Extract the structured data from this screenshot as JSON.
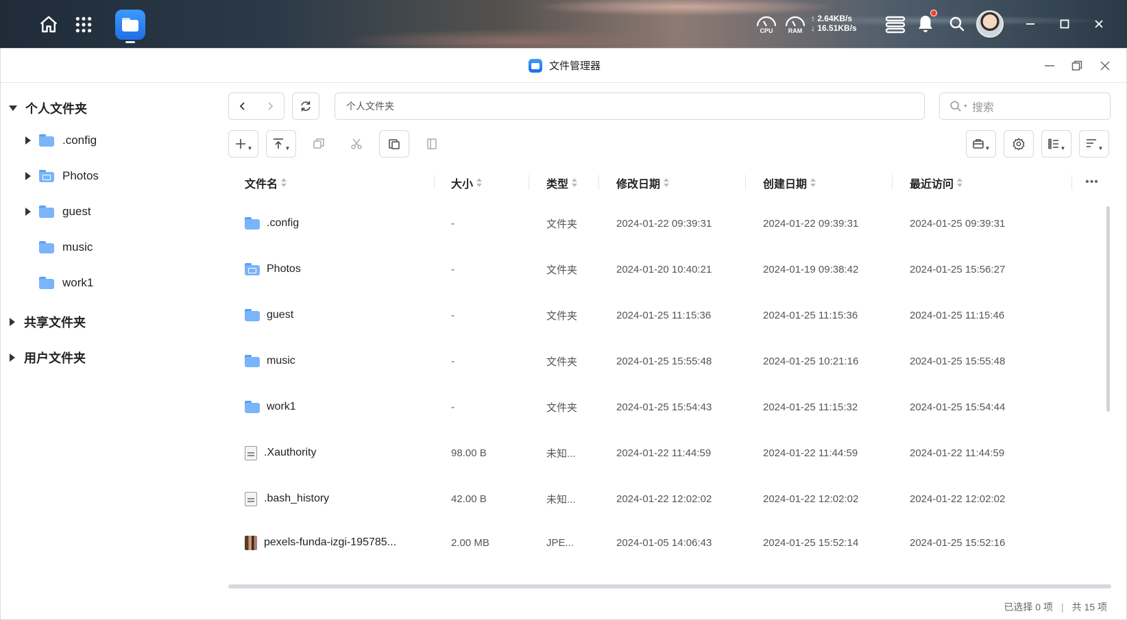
{
  "taskbar": {
    "cpu_label": "CPU",
    "ram_label": "RAM",
    "upload_speed": "↑ 2.64KB/s",
    "download_speed": "↓ 16.51KB/s"
  },
  "window": {
    "title": "文件管理器"
  },
  "sidebar": {
    "personal_label": "个人文件夹",
    "items": [
      {
        "label": ".config",
        "has_children": true,
        "icon": "folder-icon"
      },
      {
        "label": "Photos",
        "has_children": true,
        "icon": "photos-folder-icon"
      },
      {
        "label": "guest",
        "has_children": true,
        "icon": "folder-icon"
      },
      {
        "label": "music",
        "has_children": false,
        "icon": "folder-icon"
      },
      {
        "label": "work1",
        "has_children": false,
        "icon": "folder-icon"
      }
    ],
    "shared_label": "共享文件夹",
    "user_label": "用户文件夹"
  },
  "toolbar": {
    "path": "个人文件夹",
    "search_placeholder": "搜索"
  },
  "table": {
    "headers": {
      "name": "文件名",
      "size": "大小",
      "type": "类型",
      "modified": "修改日期",
      "created": "创建日期",
      "accessed": "最近访问"
    },
    "rows": [
      {
        "name": ".config",
        "icon": "folder-icon",
        "size": "-",
        "type": "文件夹",
        "modified": "2024-01-22 09:39:31",
        "created": "2024-01-22 09:39:31",
        "accessed": "2024-01-25 09:39:31"
      },
      {
        "name": "Photos",
        "icon": "photos-folder-icon",
        "size": "-",
        "type": "文件夹",
        "modified": "2024-01-20 10:40:21",
        "created": "2024-01-19 09:38:42",
        "accessed": "2024-01-25 15:56:27"
      },
      {
        "name": "guest",
        "icon": "folder-icon",
        "size": "-",
        "type": "文件夹",
        "modified": "2024-01-25 11:15:36",
        "created": "2024-01-25 11:15:36",
        "accessed": "2024-01-25 11:15:46"
      },
      {
        "name": "music",
        "icon": "folder-icon",
        "size": "-",
        "type": "文件夹",
        "modified": "2024-01-25 15:55:48",
        "created": "2024-01-25 10:21:16",
        "accessed": "2024-01-25 15:55:48"
      },
      {
        "name": "work1",
        "icon": "folder-icon",
        "size": "-",
        "type": "文件夹",
        "modified": "2024-01-25 15:54:43",
        "created": "2024-01-25 11:15:32",
        "accessed": "2024-01-25 15:54:44"
      },
      {
        "name": ".Xauthority",
        "icon": "file-icon",
        "size": "98.00 B",
        "type": "未知...",
        "modified": "2024-01-22 11:44:59",
        "created": "2024-01-22 11:44:59",
        "accessed": "2024-01-22 11:44:59"
      },
      {
        "name": ".bash_history",
        "icon": "file-icon",
        "size": "42.00 B",
        "type": "未知...",
        "modified": "2024-01-22 12:02:02",
        "created": "2024-01-22 12:02:02",
        "accessed": "2024-01-22 12:02:02"
      },
      {
        "name": "pexels-funda-izgi-195785...",
        "icon": "image-file-icon",
        "size": "2.00 MB",
        "type": "JPE...",
        "modified": "2024-01-05 14:06:43",
        "created": "2024-01-25 15:52:14",
        "accessed": "2024-01-25 15:52:16"
      }
    ]
  },
  "status": {
    "selected": "已选择 0 项",
    "separator": "|",
    "total": "共 15 项"
  },
  "colors": {
    "accent": "#1f6fe6",
    "folder": "#7ab4fb",
    "notification": "#ff3b30"
  }
}
